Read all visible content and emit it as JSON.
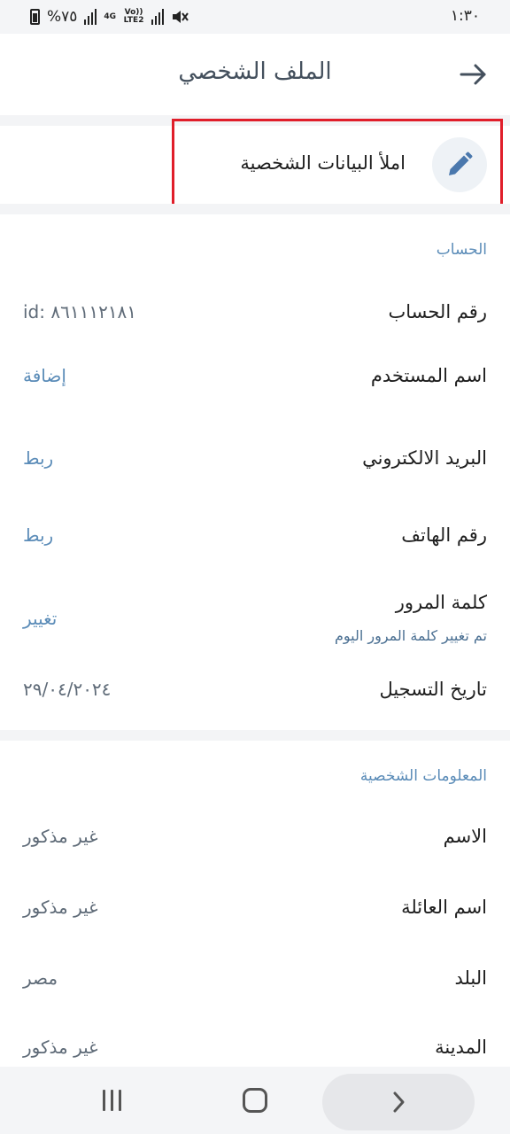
{
  "status_bar": {
    "time": "١:٣٠",
    "battery": "%٧٥",
    "network_4g": "4G",
    "network_volte": "Vo)) LTE2"
  },
  "header": {
    "title": "الملف الشخصي",
    "back_icon": "arrow-right-icon"
  },
  "fill_personal": {
    "label": "املأ البيانات الشخصية",
    "icon": "pencil-icon"
  },
  "account": {
    "section_title": "الحساب",
    "rows": [
      {
        "label": "رقم الحساب",
        "value": "id: ٨٦١١١٢١٨١"
      },
      {
        "label": "اسم المستخدم",
        "value": "إضافة"
      },
      {
        "label": "البريد الالكتروني",
        "value": "ربط"
      },
      {
        "label": "رقم الهاتف",
        "value": "ربط"
      },
      {
        "label": "كلمة المرور",
        "sublabel": "تم تغيير كلمة المرور اليوم",
        "value": "تغيير"
      },
      {
        "label": "تاريخ التسجيل",
        "value": "٢٩/٠٤/٢٠٢٤"
      }
    ]
  },
  "personal_info": {
    "section_title": "المعلومات الشخصية",
    "rows": [
      {
        "label": "الاسم",
        "value": "غير مذكور"
      },
      {
        "label": "اسم العائلة",
        "value": "غير مذكور"
      },
      {
        "label": "البلد",
        "value": "مصر"
      },
      {
        "label": "المدينة",
        "value": "غير مذكور"
      }
    ]
  },
  "colors": {
    "accent": "#5b8cb8",
    "highlight": "#e01e2a",
    "title": "#44505d"
  }
}
